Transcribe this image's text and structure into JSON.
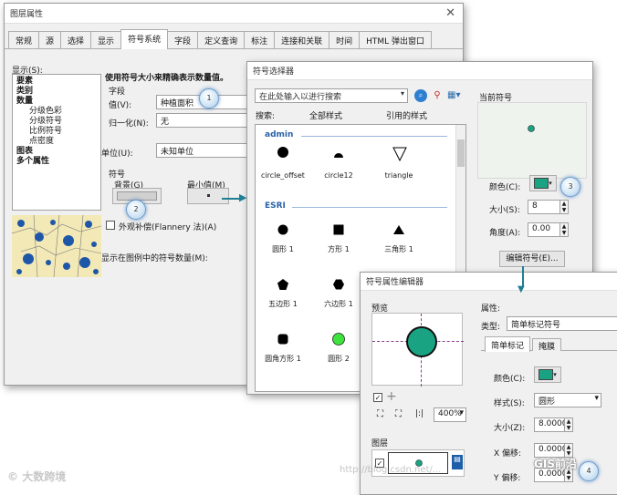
{
  "layer_props": {
    "title": "图层属性",
    "tabs": [
      "常规",
      "源",
      "选择",
      "显示",
      "符号系统",
      "字段",
      "定义查询",
      "标注",
      "连接和关联",
      "时间",
      "HTML 弹出窗口"
    ],
    "show_label": "显示(S):",
    "tree": [
      "要素",
      "类别",
      "数量",
      "分级色彩",
      "分级符号",
      "比例符号",
      "点密度",
      "图表",
      "多个属性"
    ],
    "heading": "使用符号大小来精确表示数量值。",
    "field_group": "字段",
    "value_label": "值(V):",
    "value": "种植面积",
    "normalize_label": "归一化(N):",
    "normalize_value": "无",
    "unit_label": "单位(U):",
    "unit_value": "未知单位",
    "symbol_group": "符号",
    "background_label": "背景(G)",
    "min_label": "最小值(M)",
    "flannery_label": "外观补偿(Flannery 法)(A)",
    "legend_count_label": "显示在图例中的符号数量(M):"
  },
  "symbol_selector": {
    "title": "符号选择器",
    "search_placeholder": "在此处输入以进行搜索",
    "search_label": "搜索:",
    "all_styles": "全部样式",
    "referenced_styles": "引用的样式",
    "groups": [
      {
        "name": "admin",
        "items": [
          "circle_offset",
          "circle12",
          "triangle"
        ]
      },
      {
        "name": "ESRI",
        "items": [
          "圆形 1",
          "方形 1",
          "三角形 1",
          "五边形 1",
          "六边形 1",
          "圆角方形 1",
          "圆形 2"
        ]
      }
    ],
    "current_symbol_label": "当前符号",
    "color_label": "颜色(C):",
    "size_label": "大小(S):",
    "size_value": "8",
    "angle_label": "角度(A):",
    "angle_value": "0.00",
    "edit_button": "编辑符号(E)...",
    "symbol_color": "#1aa383"
  },
  "prop_editor": {
    "title": "符号属性编辑器",
    "preview_label": "预览",
    "zoom_value": "400%",
    "layers_label": "图层",
    "properties_label": "属性:",
    "type_label": "类型:",
    "type_value": "简单标记符号",
    "tabs": [
      "简单标记",
      "掩膜"
    ],
    "color_label": "颜色(C):",
    "style_label": "样式(S):",
    "style_value": "圆形",
    "size_label": "大小(Z):",
    "size_value": "8.0000",
    "xoffset_label": "X 偏移:",
    "xoffset_value": "0.0000",
    "yoffset_label": "Y 偏移:",
    "yoffset_value": "0.0000"
  },
  "callouts": [
    "1",
    "2",
    "3",
    "4"
  ],
  "watermarks": {
    "left": "大数跨境",
    "right": "GIS前沿",
    "url": "http://blog.csdn.net/..."
  }
}
